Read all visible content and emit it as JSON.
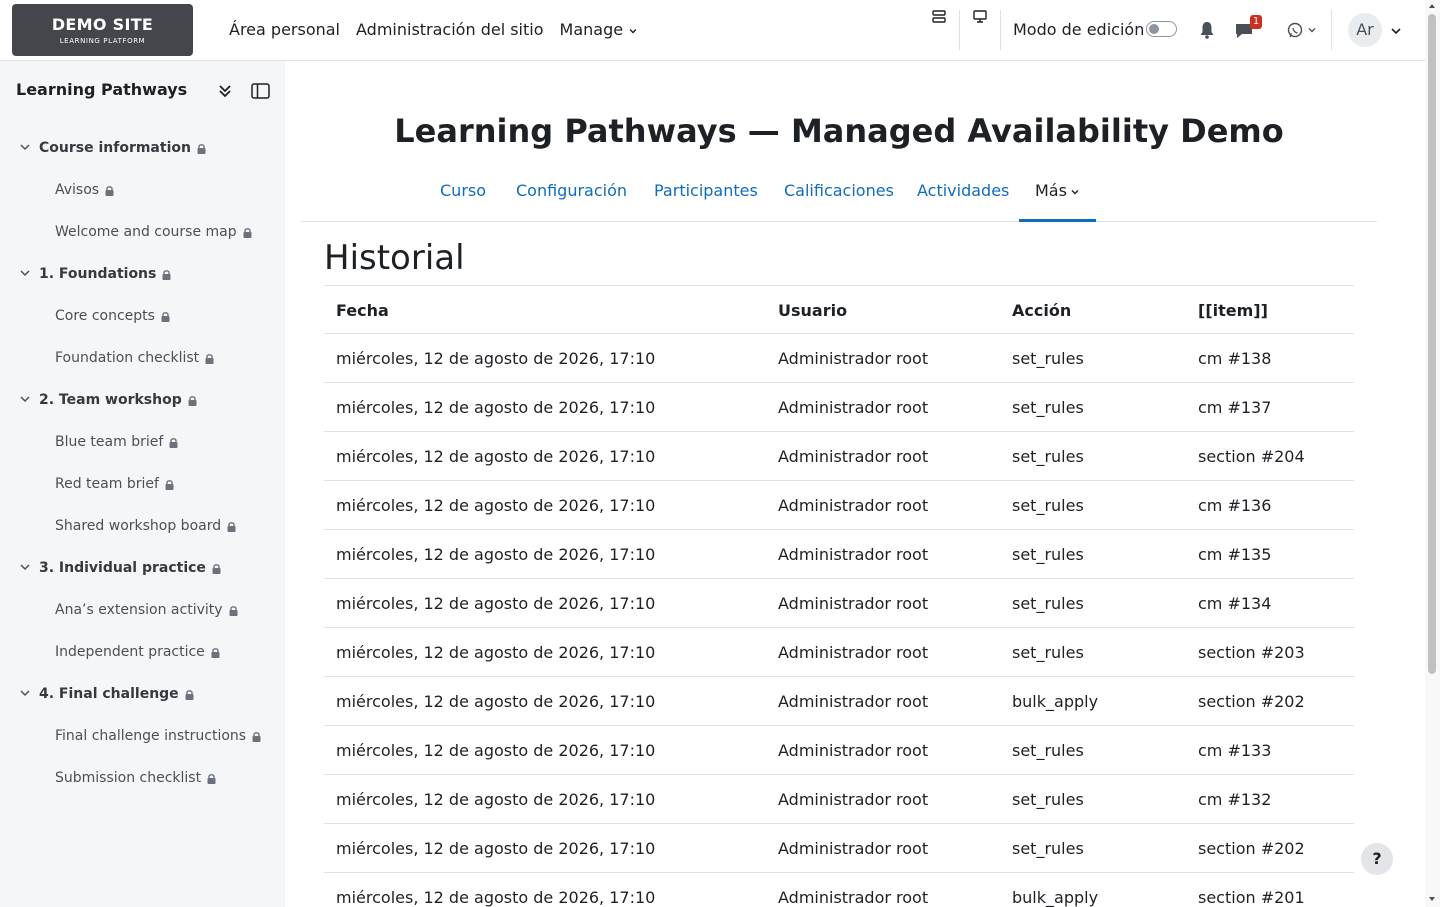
{
  "brand": {
    "title": "DEMO SITE",
    "subtitle": "LEARNING PLATFORM"
  },
  "primary_nav": {
    "home": "Área personal",
    "site_admin": "Administración del sitio",
    "manage": "Manage"
  },
  "header": {
    "edit_mode_label": "Modo de edición",
    "message_badge": "1",
    "avatar_initials": "Ar"
  },
  "drawer": {
    "title": "Learning Pathways ...",
    "sections": [
      {
        "label": "Course information",
        "items": [
          "Avisos",
          "Welcome and course map"
        ]
      },
      {
        "label": "1. Foundations",
        "items": [
          "Core concepts",
          "Foundation checklist"
        ]
      },
      {
        "label": "2. Team workshop",
        "items": [
          "Blue team brief",
          "Red team brief",
          "Shared workshop board"
        ]
      },
      {
        "label": "3. Individual practice",
        "items": [
          "Ana’s extension activity",
          "Independent practice"
        ]
      },
      {
        "label": "4. Final challenge",
        "items": [
          "Final challenge instructions",
          "Submission checklist"
        ]
      }
    ]
  },
  "page": {
    "course_title": "Learning Pathways — Managed Availability Demo",
    "tabs": [
      "Curso",
      "Configuración",
      "Participantes",
      "Calificaciones",
      "Actividades",
      "Más"
    ],
    "active_tab": "Más",
    "heading": "Historial"
  },
  "table": {
    "headers": [
      "Fecha",
      "Usuario",
      "Acción",
      "[[item]]"
    ],
    "rows": [
      [
        "miércoles, 12 de agosto de 2026, 17:10",
        "Administrador root",
        "set_rules",
        "cm #138"
      ],
      [
        "miércoles, 12 de agosto de 2026, 17:10",
        "Administrador root",
        "set_rules",
        "cm #137"
      ],
      [
        "miércoles, 12 de agosto de 2026, 17:10",
        "Administrador root",
        "set_rules",
        "section #204"
      ],
      [
        "miércoles, 12 de agosto de 2026, 17:10",
        "Administrador root",
        "set_rules",
        "cm #136"
      ],
      [
        "miércoles, 12 de agosto de 2026, 17:10",
        "Administrador root",
        "set_rules",
        "cm #135"
      ],
      [
        "miércoles, 12 de agosto de 2026, 17:10",
        "Administrador root",
        "set_rules",
        "cm #134"
      ],
      [
        "miércoles, 12 de agosto de 2026, 17:10",
        "Administrador root",
        "set_rules",
        "section #203"
      ],
      [
        "miércoles, 12 de agosto de 2026, 17:10",
        "Administrador root",
        "bulk_apply",
        "section #202"
      ],
      [
        "miércoles, 12 de agosto de 2026, 17:10",
        "Administrador root",
        "set_rules",
        "cm #133"
      ],
      [
        "miércoles, 12 de agosto de 2026, 17:10",
        "Administrador root",
        "set_rules",
        "cm #132"
      ],
      [
        "miércoles, 12 de agosto de 2026, 17:10",
        "Administrador root",
        "set_rules",
        "section #202"
      ],
      [
        "miércoles, 12 de agosto de 2026, 17:10",
        "Administrador root",
        "bulk_apply",
        "section #201"
      ]
    ]
  },
  "help_button": "?",
  "colors": {
    "link": "#0f6cbf",
    "brand_bg": "#43464b",
    "drawer_bg": "#f5f6f7",
    "badge": "#ca3120"
  },
  "icons": [
    "collapse-all-icon",
    "sidebar-toggle-icon",
    "lock-icon",
    "chevron-down-icon",
    "blocks-icon",
    "present-icon",
    "bell-icon",
    "chat-icon",
    "whatsapp-icon"
  ]
}
